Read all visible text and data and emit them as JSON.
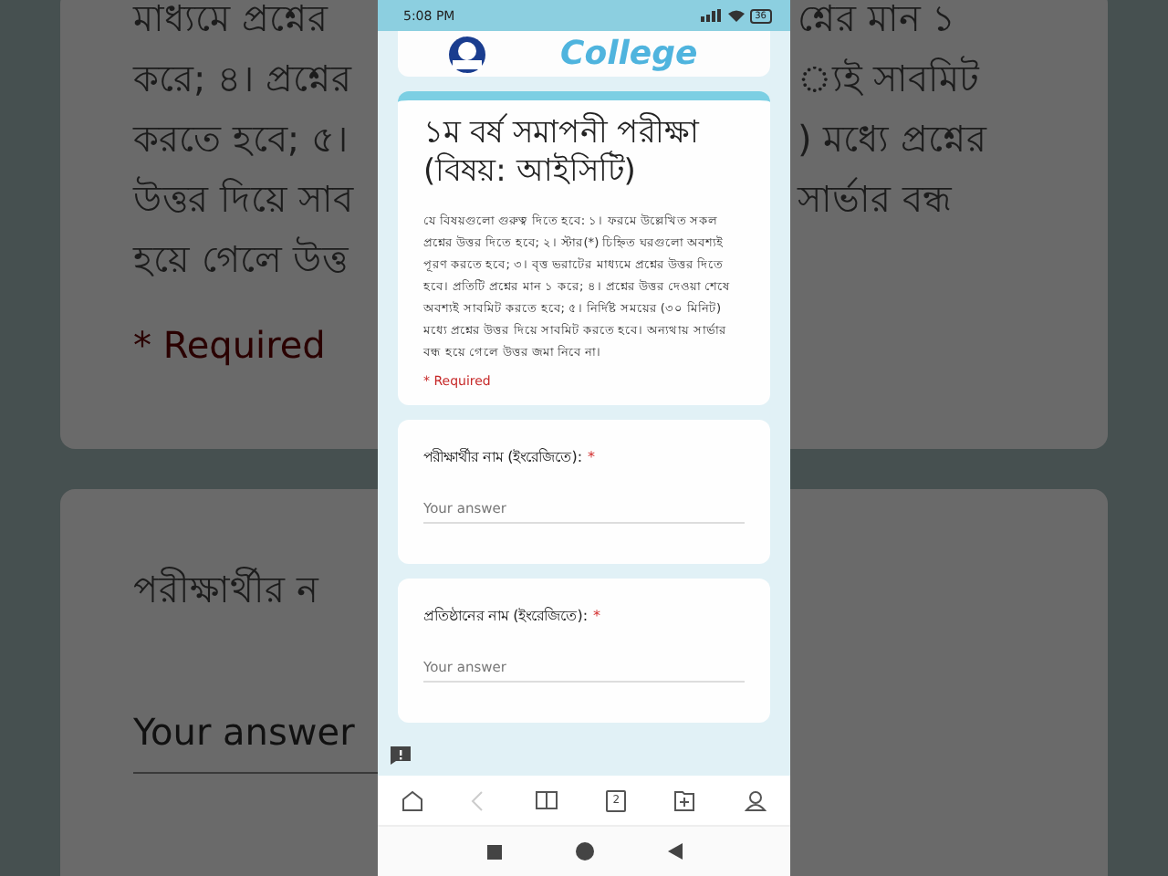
{
  "backdrop": {
    "left_lines": [
      "মাধ্যমে প্রশ্নের",
      "করে; ৪। প্রশ্নের",
      "করতে হবে; ৫।",
      "উত্তর দিয়ে সাব",
      "হয়ে গেলে উত্ত"
    ],
    "left_required": "* Required",
    "left_question": "পরীক্ষার্থীর ন",
    "left_placeholder": "Your answer",
    "right_lines": [
      "শ্নের মান ১",
      "্যই সাবমিট",
      ") মধ্যে প্রশ্নের",
      "সার্ভার বন্ধ"
    ]
  },
  "status_bar": {
    "time": "5:08 PM",
    "battery": "36"
  },
  "header": {
    "college": "College"
  },
  "form": {
    "title": "১ম বর্ষ সমাপনী পরীক্ষা (বিষয়: আইসিটি)",
    "description": "যে বিষয়গুলো গুরুত্ব দিতে হবে: ১। ফরমে উল্লেখিত সকল প্রশ্নের উত্তর দিতে হবে; ২। স্টার(*) চিহ্নিত ঘরগুলো অবশ্যই পূরণ করতে হবে; ৩। বৃত্ত ভরাটের মাধ্যমে প্রশ্নের উত্তর দিতে হবে। প্রতিটি প্রশ্নের মান ১ করে; ৪। প্রশ্নের উত্তর দেওয়া শেষে অবশ্যই সাবমিট করতে হবে; ৫। নির্দিষ্ট সময়ের (৩০ মিনিট) মধ্যে প্রশ্নের উত্তর দিয়ে সাবমিট করতে হবে। অন্যথায় সার্ভার বন্ধ হয়ে গেলে উত্তর জমা নিবে না।",
    "required_note": "* Required"
  },
  "questions": [
    {
      "label": "পরীক্ষার্থীর নাম (ইংরেজিতে):",
      "required_mark": "*",
      "placeholder": "Your answer"
    },
    {
      "label": "প্রতিষ্ঠানের নাম (ইংরেজিতে):",
      "required_mark": "*",
      "placeholder": "Your answer"
    }
  ],
  "browser_nav": [
    {
      "kind": "home",
      "disabled": false
    },
    {
      "kind": "back",
      "disabled": true
    },
    {
      "kind": "book",
      "disabled": false
    },
    {
      "kind": "tabs",
      "disabled": false,
      "count": "2"
    },
    {
      "kind": "folder",
      "disabled": false
    },
    {
      "kind": "profile",
      "disabled": false
    }
  ],
  "system_nav": [
    {
      "kind": "square"
    },
    {
      "kind": "circle"
    },
    {
      "kind": "triangle"
    }
  ]
}
